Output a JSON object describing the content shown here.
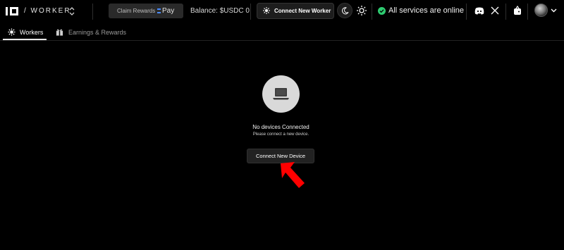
{
  "brand": {
    "logo_icon": "io-logo",
    "product": "/ WORKER"
  },
  "header": {
    "claim_rewards_label": "Claim Rewards",
    "pay_label": "Pay",
    "balance_text": "Balance: $USDC 0",
    "connect_worker_label": "Connect New Worker",
    "status_text": "All services are online",
    "status_color": "#2ecc71"
  },
  "tabs": [
    {
      "label": "Workers",
      "icon": "gear-icon",
      "active": true
    },
    {
      "label": "Earnings & Rewards",
      "icon": "gift-icon",
      "active": false
    }
  ],
  "empty_state": {
    "icon": "laptop-icon",
    "title": "No devices Connected",
    "subtitle": "Please connect a new device.",
    "button_label": "Connect New Device"
  },
  "annotation": {
    "arrow_color": "#ff0000"
  }
}
